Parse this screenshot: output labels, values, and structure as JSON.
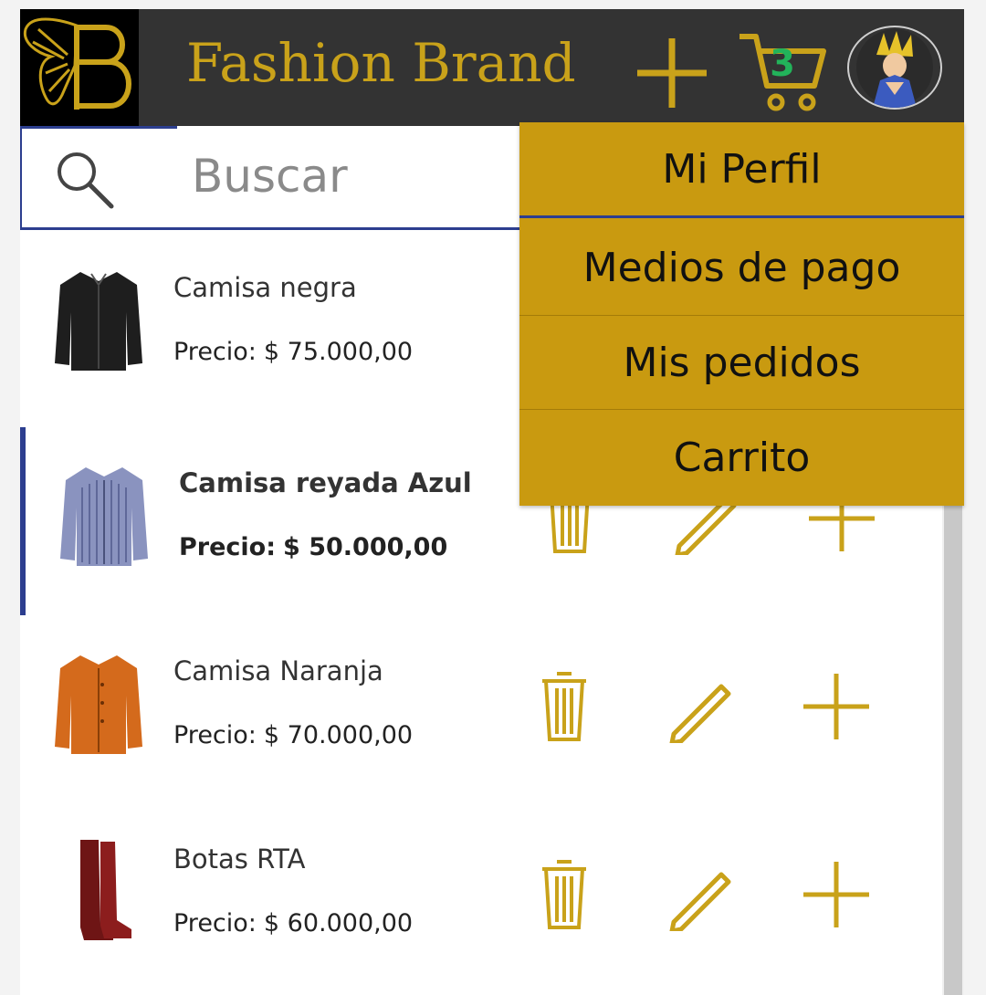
{
  "header": {
    "brand_name": "Fashion Brand",
    "logo_letter": "B",
    "cart_count": "3",
    "accent_color": "#c9a21a",
    "background_color": "#333333",
    "icons": [
      "add-icon",
      "cart-icon",
      "avatar"
    ]
  },
  "search": {
    "placeholder": "Buscar"
  },
  "products": [
    {
      "name": "Camisa negra",
      "price_label": "Precio:",
      "price": "$ 75.000,00"
    },
    {
      "name": "Camisa reyada Azul",
      "price_label": "Precio:",
      "price": "$ 50.000,00"
    },
    {
      "name": "Camisa Naranja",
      "price_label": "Precio:",
      "price": "$ 70.000,00"
    },
    {
      "name": "Botas RTA",
      "price_label": "Precio:",
      "price": "$ 60.000,00"
    }
  ],
  "item_actions": [
    "delete-icon",
    "edit-icon",
    "add-icon"
  ],
  "user_menu": {
    "items": [
      {
        "label": "Mi Perfil"
      },
      {
        "label": "Medios de pago"
      },
      {
        "label": "Mis pedidos"
      },
      {
        "label": "Carrito"
      }
    ],
    "background_color": "#c99a10"
  },
  "selection_color": "#2c3e8f"
}
